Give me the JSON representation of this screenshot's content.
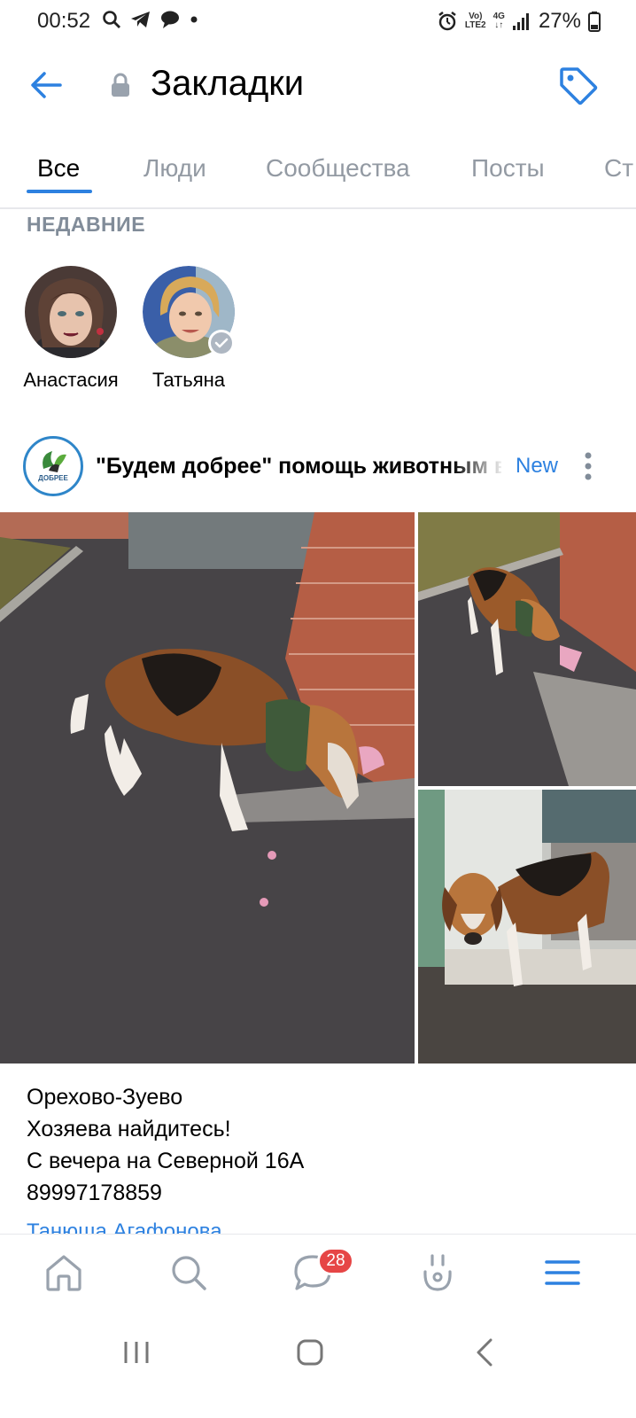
{
  "status_bar": {
    "time": "00:52",
    "network_top": "Vo)",
    "network_bottom": "LTE2",
    "gen": "4G",
    "battery": "27%"
  },
  "header": {
    "title": "Закладки"
  },
  "tabs": [
    {
      "label": "Все",
      "active": true
    },
    {
      "label": "Люди",
      "active": false
    },
    {
      "label": "Сообщества",
      "active": false
    },
    {
      "label": "Посты",
      "active": false
    },
    {
      "label": "Ст",
      "active": false
    }
  ],
  "recent": {
    "label": "НЕДАВНИЕ",
    "contacts": [
      {
        "name": "Анастасия"
      },
      {
        "name": "Татьяна"
      }
    ]
  },
  "post": {
    "community_name": "\"Будем добрее\" помощь животным в Ор",
    "logo_text": "ДОБРЕЕ",
    "new_label": "New",
    "text_lines": [
      "Орехово-Зуево",
      "Хозяева найдитесь!",
      "С вечера на Северной 16А",
      "89997178859"
    ],
    "author_link": "Танюша Агафонова"
  },
  "bottom_nav": {
    "badge_count": "28",
    "items": [
      "home-icon",
      "search-icon",
      "messages-icon",
      "clips-icon",
      "menu-icon"
    ]
  },
  "colors": {
    "accent": "#2d81e0",
    "badge": "#e64646",
    "secondary_text": "#818c99"
  }
}
